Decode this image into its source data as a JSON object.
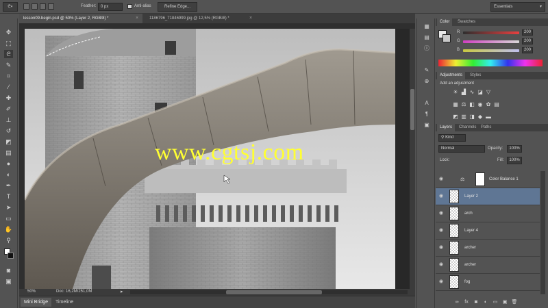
{
  "options_bar": {
    "feather_label": "Feather:",
    "feather_value": "0 px",
    "antialias_label": "Anti-alias",
    "refine_edge_label": "Refine Edge...",
    "workspace": "Essentials"
  },
  "document_tabs": [
    {
      "label": "lesson09-begin.psd @ 50% (Layer 2, RGB/8) *",
      "active": true
    },
    {
      "label": "1186796_71846999.jpg @ 12,5% (RGB/8) *",
      "active": false
    }
  ],
  "status": {
    "zoom": "50%",
    "doc": "Doc: 16,2M/251,0M"
  },
  "bottom_tabs": [
    {
      "label": "Mini Bridge",
      "active": true
    },
    {
      "label": "Timeline",
      "active": false
    }
  ],
  "watermark": "www.cgtsj.com",
  "color_panel": {
    "tabs": [
      "Color",
      "Swatches"
    ],
    "channels": [
      {
        "letter": "R",
        "value": "200",
        "gradient": "linear-gradient(to right,#2e2e2e,#e84040)"
      },
      {
        "letter": "G",
        "value": "200",
        "gradient": "linear-gradient(to right,#d040c0,#d8d8d8)"
      },
      {
        "letter": "B",
        "value": "200",
        "gradient": "linear-gradient(to right,#c8c840,#c0c0f0)"
      }
    ]
  },
  "adjustments_panel": {
    "tabs": [
      "Adjustments",
      "Styles"
    ],
    "heading": "Add an adjustment"
  },
  "layers_panel": {
    "tabs": [
      "Layers",
      "Channels",
      "Paths"
    ],
    "kind_label": "Kind",
    "blend_mode": "Normal",
    "opacity_label": "Opacity:",
    "opacity_value": "100%",
    "lock_label": "Lock:",
    "fill_label": "Fill:",
    "fill_value": "100%",
    "layers": [
      {
        "name": "Color Balance 1",
        "selected": false,
        "kind": "adjustment"
      },
      {
        "name": "Layer 2",
        "selected": true,
        "kind": "pixel"
      },
      {
        "name": "arch",
        "selected": false,
        "kind": "pixel"
      },
      {
        "name": "Layer 4",
        "selected": false,
        "kind": "pixel"
      },
      {
        "name": "archer",
        "selected": false,
        "kind": "pixel"
      },
      {
        "name": "archer",
        "selected": false,
        "kind": "pixel"
      },
      {
        "name": "fog",
        "selected": false,
        "kind": "pixel"
      }
    ]
  },
  "colors": {
    "accent_selected_layer": "#5f7694",
    "watermark": "#ffff33"
  }
}
